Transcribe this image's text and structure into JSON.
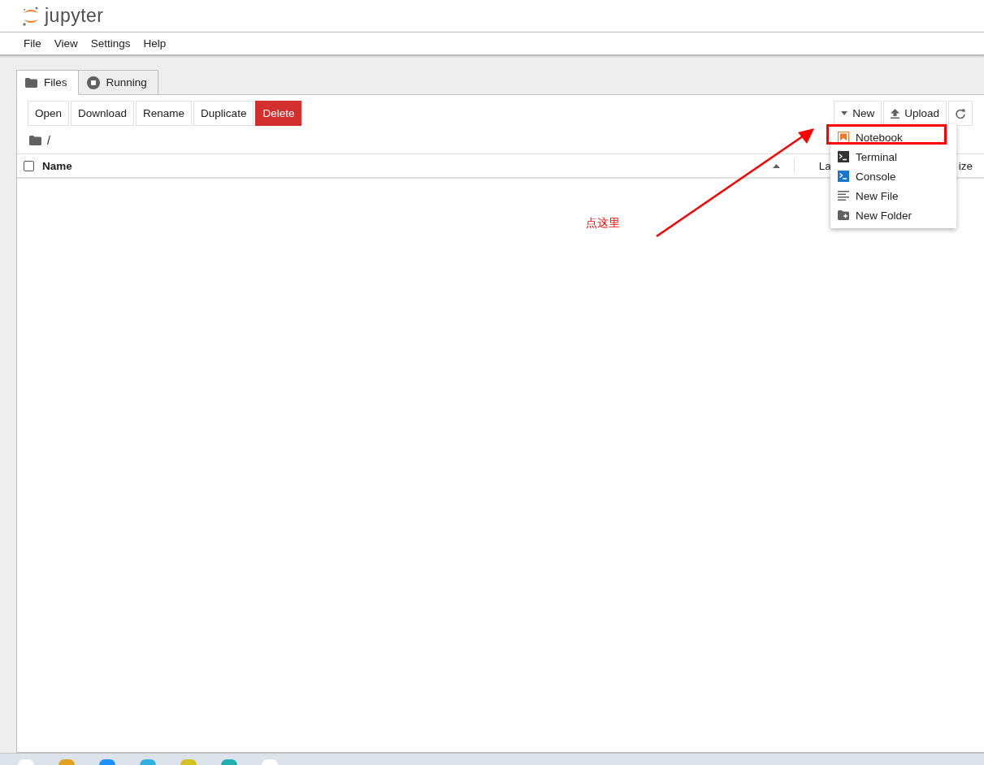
{
  "header": {
    "logo_text": "jupyter"
  },
  "menubar": [
    "File",
    "View",
    "Settings",
    "Help"
  ],
  "tabs": [
    {
      "label": "Files",
      "kind": "folder",
      "selected": true
    },
    {
      "label": "Running",
      "kind": "running",
      "selected": false
    }
  ],
  "toolbar": {
    "left": [
      {
        "label": "Open",
        "kind": "plain"
      },
      {
        "label": "Download",
        "kind": "plain"
      },
      {
        "label": "Rename",
        "kind": "plain"
      },
      {
        "label": "Duplicate",
        "kind": "plain"
      },
      {
        "label": "Delete",
        "kind": "danger"
      }
    ],
    "right": [
      {
        "label": "New",
        "kind": "caret"
      },
      {
        "label": "Upload",
        "kind": "upload"
      },
      {
        "kind": "refresh"
      }
    ]
  },
  "breadcrumb": "/",
  "table": {
    "select_all_checked": false,
    "columns": [
      {
        "label": "Name"
      },
      {
        "label": "La"
      },
      {
        "label": "ize"
      }
    ]
  },
  "new_menu": [
    {
      "label": "Notebook",
      "kind": "notebook",
      "highlighted": true
    },
    {
      "label": "Terminal",
      "kind": "terminal",
      "highlighted": false
    },
    {
      "label": "Console",
      "kind": "console",
      "highlighted": false
    },
    {
      "label": "New File",
      "kind": "file",
      "highlighted": false
    },
    {
      "label": "New Folder",
      "kind": "newfolder",
      "highlighted": false
    }
  ],
  "annotation": {
    "text": "点这里"
  }
}
